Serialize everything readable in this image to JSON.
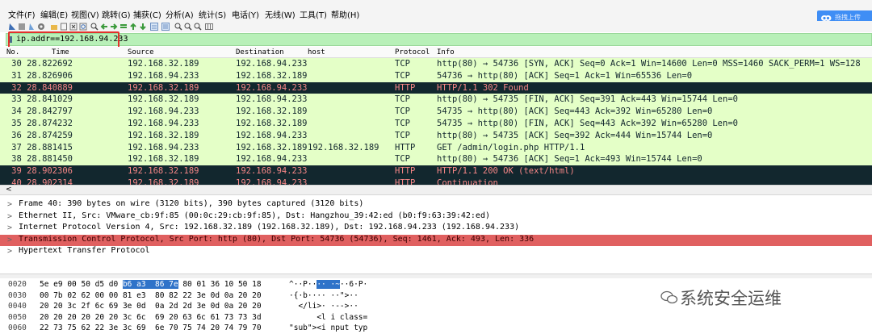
{
  "menu": [
    "文件(F)",
    "编辑(E)",
    "视图(V)",
    "跳转(G)",
    "捕获(C)",
    "分析(A)",
    "统计(S)",
    "电话(Y)",
    "无线(W)",
    "工具(T)",
    "帮助(H)"
  ],
  "upload_label": "拖拽上传",
  "filter": {
    "value": "ip.addr==192.168.94.233"
  },
  "columns": {
    "no": "No.",
    "time": "Time",
    "source": "Source",
    "destination": "Destination",
    "host": "host",
    "protocol": "Protocol",
    "info": "Info"
  },
  "packets": [
    {
      "no_time": "30 28.822692",
      "src": "192.168.32.189",
      "dst": "192.168.94.233",
      "host": "",
      "proto": "TCP",
      "info": "http(80) → 54736 [SYN, ACK] Seq=0 Ack=1 Win=14600 Len=0 MSS=1460 SACK_PERM=1 WS=128",
      "style": "tcp"
    },
    {
      "no_time": "31 28.826906",
      "src": "192.168.94.233",
      "dst": "192.168.32.189",
      "host": "",
      "proto": "TCP",
      "info": "54736 → http(80) [ACK] Seq=1 Ack=1 Win=65536 Len=0",
      "style": "tcp"
    },
    {
      "no_time": "32 28.840889",
      "src": "192.168.32.189",
      "dst": "192.168.94.233",
      "host": "",
      "proto": "HTTP",
      "info": "HTTP/1.1 302 Found",
      "style": "dark"
    },
    {
      "no_time": "33 28.841029",
      "src": "192.168.32.189",
      "dst": "192.168.94.233",
      "host": "",
      "proto": "TCP",
      "info": "http(80) → 54735 [FIN, ACK] Seq=391 Ack=443 Win=15744 Len=0",
      "style": "tcp"
    },
    {
      "no_time": "34 28.842797",
      "src": "192.168.94.233",
      "dst": "192.168.32.189",
      "host": "",
      "proto": "TCP",
      "info": "54735 → http(80) [ACK] Seq=443 Ack=392 Win=65280 Len=0",
      "style": "tcp"
    },
    {
      "no_time": "35 28.874232",
      "src": "192.168.94.233",
      "dst": "192.168.32.189",
      "host": "",
      "proto": "TCP",
      "info": "54735 → http(80) [FIN, ACK] Seq=443 Ack=392 Win=65280 Len=0",
      "style": "tcp"
    },
    {
      "no_time": "36 28.874259",
      "src": "192.168.32.189",
      "dst": "192.168.94.233",
      "host": "",
      "proto": "TCP",
      "info": "http(80) → 54735 [ACK] Seq=392 Ack=444 Win=15744 Len=0",
      "style": "tcp"
    },
    {
      "no_time": "37 28.881415",
      "src": "192.168.94.233",
      "dst": "192.168.32.189",
      "host": "192.168.32.189",
      "proto": "HTTP",
      "info": "GET /admin/login.php HTTP/1.1",
      "style": "http"
    },
    {
      "no_time": "38 28.881450",
      "src": "192.168.32.189",
      "dst": "192.168.94.233",
      "host": "",
      "proto": "TCP",
      "info": "http(80) → 54736 [ACK] Seq=1 Ack=493 Win=15744 Len=0",
      "style": "tcp"
    },
    {
      "no_time": "39 28.902306",
      "src": "192.168.32.189",
      "dst": "192.168.94.233",
      "host": "",
      "proto": "HTTP",
      "info": "HTTP/1.1 200 OK  (text/html)",
      "style": "dark"
    },
    {
      "no_time": "40 28.902314",
      "src": "192.168.32.189",
      "dst": "192.168.94.233",
      "host": "",
      "proto": "HTTP",
      "info": "Continuation",
      "style": "dark"
    }
  ],
  "details": [
    {
      "text": "Frame 40: 390 bytes on wire (3120 bits), 390 bytes captured (3120 bits)",
      "selected": false
    },
    {
      "text": "Ethernet II, Src: VMware_cb:9f:85 (00:0c:29:cb:9f:85), Dst: Hangzhou_39:42:ed (b0:f9:63:39:42:ed)",
      "selected": false
    },
    {
      "text": "Internet Protocol Version 4, Src: 192.168.32.189 (192.168.32.189), Dst: 192.168.94.233 (192.168.94.233)",
      "selected": false
    },
    {
      "text": "Transmission Control Protocol, Src Port: http (80), Dst Port: 54736 (54736), Seq: 1461, Ack: 493, Len: 336",
      "selected": true
    },
    {
      "text": "Hypertext Transfer Protocol",
      "selected": false
    }
  ],
  "bytes_rows": [
    {
      "offset": "0020",
      "hex_a": "5e e9 00 50 d5 d0 ",
      "hex_hl": "b6 a3  86 7e",
      "hex_b": " 80 01 36 10 50 18",
      "ascii_a": "^··P··",
      "ascii_hl": "·· ·~",
      "ascii_b": "··6·P·"
    },
    {
      "offset": "0030",
      "hex_a": "00 7b 02 62 00 00 81 e3  80 82 22 3e 0d 0a 20 20",
      "hex_hl": "",
      "hex_b": "",
      "ascii_a": "·{·b···· ··\">··",
      "ascii_hl": "",
      "ascii_b": ""
    },
    {
      "offset": "0040",
      "hex_a": "20 20 3c 2f 6c 69 3e 0d  0a 2d 2d 3e 0d 0a 20 20",
      "hex_hl": "",
      "hex_b": "",
      "ascii_a": "  </li>· ·-->··",
      "ascii_hl": "",
      "ascii_b": ""
    },
    {
      "offset": "0050",
      "hex_a": "20 20 20 20 20 20 3c 6c  69 20 63 6c 61 73 73 3d",
      "hex_hl": "",
      "hex_b": "",
      "ascii_a": "      <l i class=",
      "ascii_hl": "",
      "ascii_b": ""
    },
    {
      "offset": "0060",
      "hex_a": "22 73 75 62 22 3e 3c 69  6e 70 75 74 20 74 79 70",
      "hex_hl": "",
      "hex_b": "",
      "ascii_a": "\"sub\"><i nput typ",
      "ascii_hl": "",
      "ascii_b": ""
    }
  ],
  "watermark": "系统安全运维"
}
